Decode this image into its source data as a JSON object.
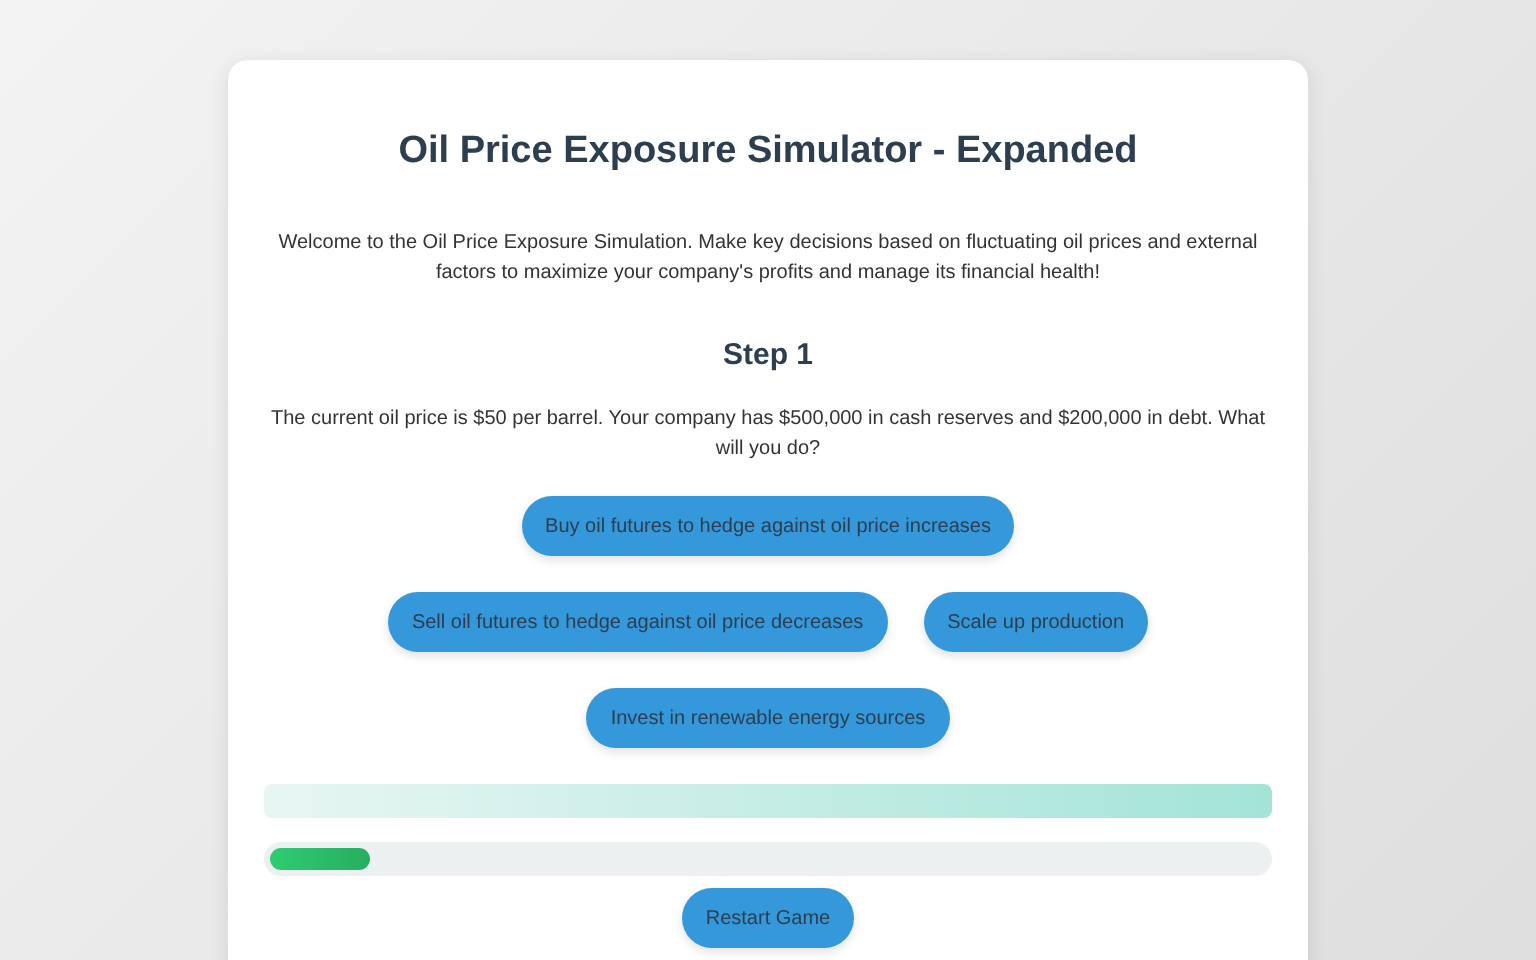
{
  "title": "Oil Price Exposure Simulator - Expanded",
  "intro": "Welcome to the Oil Price Exposure Simulation. Make key decisions based on fluctuating oil prices and external factors to maximize your company's profits and manage its financial health!",
  "step": {
    "heading": "Step 1",
    "question": "The current oil price is $50 per barrel. Your company has $500,000 in cash reserves and $200,000 in debt. What will you do?"
  },
  "choices": [
    {
      "label": "Buy oil futures to hedge against oil price increases"
    },
    {
      "label": "Sell oil futures to hedge against oil price decreases"
    },
    {
      "label": "Scale up production"
    },
    {
      "label": "Invest in renewable energy sources"
    }
  ],
  "progress": {
    "level": 0.1
  },
  "restart_button": "Restart Game"
}
